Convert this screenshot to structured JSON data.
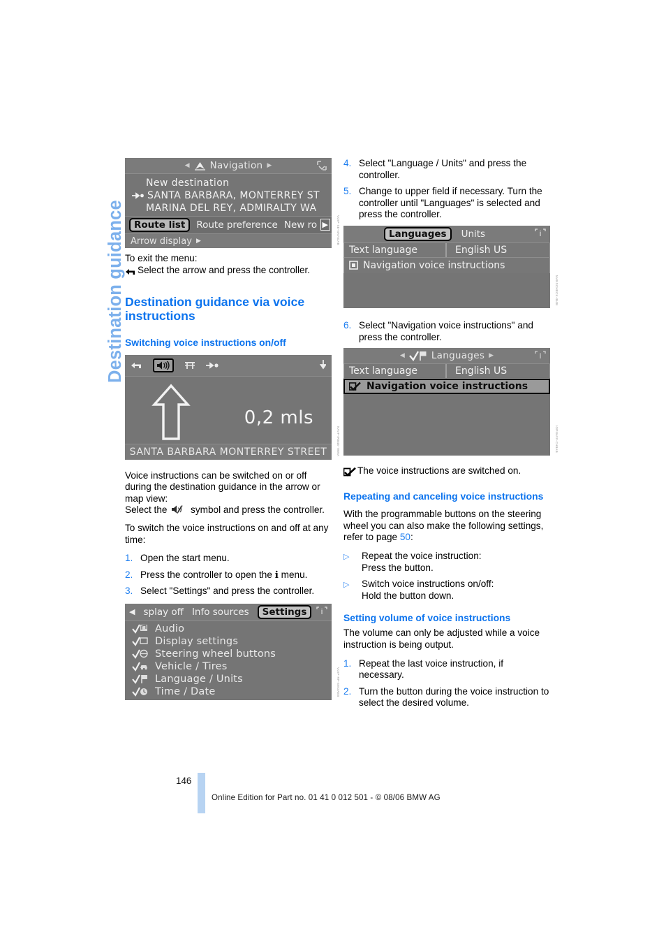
{
  "chapter": {
    "title": "Destination guidance"
  },
  "footer": {
    "page_number": "146",
    "text": "Online Edition for Part no. 01 41 0 012 501 - © 08/06 BMW AG",
    "accent_color": "#b7d3f2"
  },
  "theme": {
    "heading_blue": "#0d74ee",
    "chapter_blue": "#7cb0ec",
    "screen_gray": "#777777"
  },
  "left_column": {
    "nav_screen": {
      "title": "Navigation",
      "lines": [
        "New destination",
        "SANTA BARBARA, MONTERREY ST",
        "MARINA DEL REY, ADMIRALTY WA"
      ],
      "tabs": [
        "Route list",
        "Route preference",
        "New ro"
      ],
      "selected_tab": "Route list",
      "footer_item": "Arrow display",
      "sidecode": "VOIP-SE-NAVIGAB"
    },
    "exit_menu": {
      "label": "To exit the menu:",
      "instruction": "Select the arrow and press the controller."
    },
    "heading_main": "Destination guidance via voice instructions",
    "heading_sub": "Switching voice instructions on/off",
    "guidance_screen": {
      "distance": "0,2 mls",
      "street": "SANTA BARBARA MONTERREY STREET",
      "sidecode": "NAVF-IRB4E-78WA"
    },
    "body_1": "Voice instructions can be switched on or off during the destination guidance in the arrow or map view:",
    "body_2_pre": "Select the",
    "body_2_post": "symbol and press the controller.",
    "body_3": "To switch the voice instructions on and off at any time:",
    "steps": [
      {
        "num": "1.",
        "text": "Open the start menu."
      },
      {
        "num": "2.",
        "text": "Press the controller to open the ℹ menu."
      },
      {
        "num": "3.",
        "text": "Select \"Settings\" and press the controller."
      }
    ],
    "settings_screen": {
      "tabs": [
        "splay off",
        "Info sources",
        "Settings"
      ],
      "selected_tab": "Settings",
      "items": [
        "Audio",
        "Display settings",
        "Steering wheel buttons",
        "Vehicle / Tires",
        "Language / Units",
        "Time / Date"
      ],
      "sidecode": "VOIP-RP-SMGAEB"
    }
  },
  "right_column": {
    "steps_top": [
      {
        "num": "4.",
        "text": "Select \"Language / Units\" and press the controller."
      },
      {
        "num": "5.",
        "text": "Change to upper field if necessary. Turn the controller until \"Languages\" is selected and press the controller."
      }
    ],
    "languages_screen_off": {
      "tabs": [
        "Languages",
        "Units"
      ],
      "selected_tab": "Languages",
      "row_label": "Text language",
      "row_value": "English US",
      "checkbox_label": "Navigation voice instructions",
      "checkbox_checked": false,
      "sidecode": "MANSCHECK-IB4B"
    },
    "step_6": {
      "num": "6.",
      "text": "Select \"Navigation voice instructions\" and press the controller."
    },
    "languages_screen_on": {
      "title": "Languages",
      "row_label": "Text language",
      "row_value": "English US",
      "checkbox_label": "Navigation voice instructions",
      "checkbox_checked": true,
      "sidecode": "IOPNAVF-CH9AB"
    },
    "note_on": "The voice instructions are switched on.",
    "heading_repeat": "Repeating and canceling voice instructions",
    "repeat_intro_pre": "With the programmable buttons on the steering wheel you can also make the following settings, refer to page",
    "repeat_intro_page": "50",
    "repeat_intro_post": ":",
    "bullets": [
      {
        "line1": "Repeat the voice instruction:",
        "line2": "Press the button."
      },
      {
        "line1": "Switch voice instructions on/off:",
        "line2": "Hold the button down."
      }
    ],
    "heading_volume": "Setting volume of voice instructions",
    "volume_intro": "The volume can only be adjusted while a voice instruction is being output.",
    "volume_steps": [
      {
        "num": "1.",
        "text": "Repeat the last voice instruction, if necessary."
      },
      {
        "num": "2.",
        "text": "Turn the button during the voice instruction to select the desired volume."
      }
    ]
  },
  "icons": {
    "back_arrow": "back-arrow-icon",
    "speaker": "speaker-icon",
    "speaker_muted": "speaker-muted-icon",
    "highway": "highway-icon",
    "destination": "destination-flag-icon",
    "checkmark": "checkmark-icon",
    "checkbox": "checkbox-icon"
  }
}
